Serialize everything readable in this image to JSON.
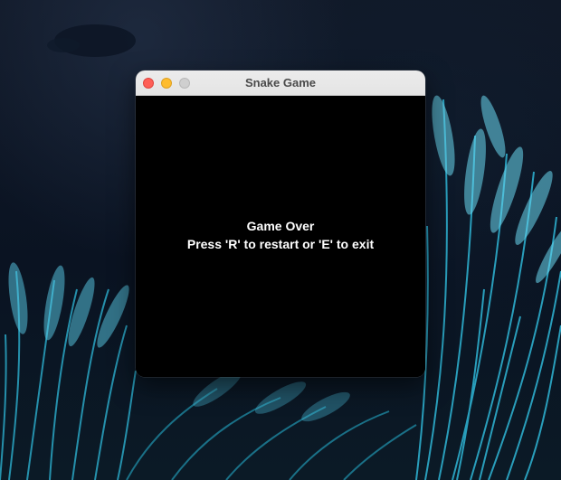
{
  "window": {
    "title": "Snake Game"
  },
  "game": {
    "status_title": "Game Over",
    "instructions": "Press 'R' to restart or 'E' to exit"
  },
  "colors": {
    "canvas_background": "#000000",
    "text": "#ffffff",
    "close_button": "#fe5f57",
    "minimize_button": "#febc2e",
    "zoom_button_inactive": "#cfcfcf"
  }
}
